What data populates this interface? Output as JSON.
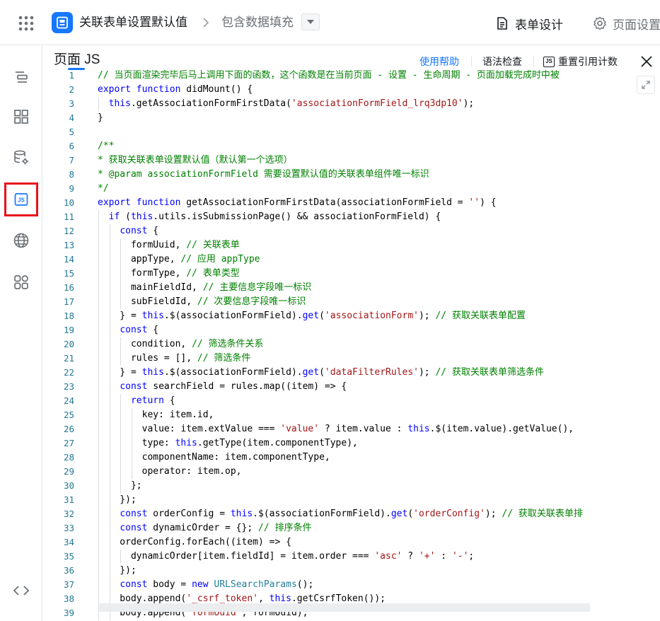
{
  "topbar": {
    "app_title": "关联表单设置默认值",
    "page_name": "包含数据填充",
    "tab_form": "表单设计",
    "tab_page": "页面设置"
  },
  "panel": {
    "title": "页面 JS",
    "help": "使用帮助",
    "lint": "语法检查",
    "reset": "重置引用计数",
    "js_badge": "JS"
  },
  "rail_icons": [
    "outline-icon",
    "components-icon",
    "datasource-icon",
    "js-icon",
    "globe-icon",
    "plugins-icon",
    "code-icon"
  ],
  "colors": {
    "accent": "#1677ff",
    "active_outline": "#e8121c",
    "keyword": "#0000ff",
    "string": "#a31515",
    "comment": "#008000"
  },
  "code_lines": [
    {
      "n": "1",
      "tokens": [
        [
          "// 当页面渲染完毕后马上调用下面的函数，这个函数是在当前页面 - 设置 - 生命周期 - 页面加载完成时中被",
          "cmt"
        ]
      ]
    },
    {
      "n": "2",
      "tokens": [
        [
          "export",
          "kw"
        ],
        [
          " ",
          ""
        ],
        [
          "function",
          "kw"
        ],
        [
          " didMount() {",
          ""
        ]
      ]
    },
    {
      "n": "3",
      "tokens": [
        [
          "  ",
          ""
        ],
        [
          "this",
          "kw"
        ],
        [
          ".getAssociationFormFirstData(",
          ""
        ],
        [
          "'associationFormField_lrq3dp10'",
          "str"
        ],
        [
          ");",
          ""
        ]
      ]
    },
    {
      "n": "4",
      "tokens": [
        [
          "}",
          ""
        ]
      ]
    },
    {
      "n": "5",
      "tokens": [
        [
          "",
          ""
        ]
      ]
    },
    {
      "n": "6",
      "tokens": [
        [
          "/**",
          "cmt"
        ]
      ]
    },
    {
      "n": "7",
      "tokens": [
        [
          "* 获取关联表单设置默认值（默认第一个选项）",
          "cmt"
        ]
      ]
    },
    {
      "n": "8",
      "tokens": [
        [
          "* @param associationFormField 需要设置默认值的关联表单组件唯一标识",
          "cmt"
        ]
      ]
    },
    {
      "n": "9",
      "tokens": [
        [
          "*/",
          "cmt"
        ]
      ]
    },
    {
      "n": "10",
      "tokens": [
        [
          "export",
          "kw"
        ],
        [
          " ",
          ""
        ],
        [
          "function",
          "kw"
        ],
        [
          " getAssociationFormFirstData(associationFormField = ",
          ""
        ],
        [
          "''",
          "str"
        ],
        [
          ") {",
          ""
        ]
      ]
    },
    {
      "n": "11",
      "tokens": [
        [
          "  ",
          ""
        ],
        [
          "if",
          "kw"
        ],
        [
          " (",
          ""
        ],
        [
          "this",
          "kw"
        ],
        [
          ".utils.isSubmissionPage() && associationFormField) {",
          ""
        ]
      ]
    },
    {
      "n": "12",
      "tokens": [
        [
          "    ",
          ""
        ],
        [
          "const",
          "kw"
        ],
        [
          " {",
          ""
        ]
      ]
    },
    {
      "n": "13",
      "tokens": [
        [
          "      formUuid, ",
          ""
        ],
        [
          "// 关联表单",
          "cmt"
        ]
      ]
    },
    {
      "n": "14",
      "tokens": [
        [
          "      appType, ",
          ""
        ],
        [
          "// 应用 appType",
          "cmt"
        ]
      ]
    },
    {
      "n": "15",
      "tokens": [
        [
          "      formType, ",
          ""
        ],
        [
          "// 表单类型",
          "cmt"
        ]
      ]
    },
    {
      "n": "16",
      "tokens": [
        [
          "      mainFieldId, ",
          ""
        ],
        [
          "// 主要信息字段唯一标识",
          "cmt"
        ]
      ]
    },
    {
      "n": "17",
      "tokens": [
        [
          "      subFieldId, ",
          ""
        ],
        [
          "// 次要信息字段唯一标识",
          "cmt"
        ]
      ]
    },
    {
      "n": "18",
      "tokens": [
        [
          "    } = ",
          ""
        ],
        [
          "this",
          "kw"
        ],
        [
          ".$(associationFormField).",
          ""
        ],
        [
          "get",
          "kw"
        ],
        [
          "(",
          ""
        ],
        [
          "'associationForm'",
          "str"
        ],
        [
          "); ",
          ""
        ],
        [
          "// 获取关联表单配置",
          "cmt"
        ]
      ]
    },
    {
      "n": "19",
      "tokens": [
        [
          "    ",
          ""
        ],
        [
          "const",
          "kw"
        ],
        [
          " {",
          ""
        ]
      ]
    },
    {
      "n": "20",
      "tokens": [
        [
          "      condition, ",
          ""
        ],
        [
          "// 筛选条件关系",
          "cmt"
        ]
      ]
    },
    {
      "n": "21",
      "tokens": [
        [
          "      rules = [], ",
          ""
        ],
        [
          "// 筛选条件",
          "cmt"
        ]
      ]
    },
    {
      "n": "22",
      "tokens": [
        [
          "    } = ",
          ""
        ],
        [
          "this",
          "kw"
        ],
        [
          ".$(associationFormField).",
          ""
        ],
        [
          "get",
          "kw"
        ],
        [
          "(",
          ""
        ],
        [
          "'dataFilterRules'",
          "str"
        ],
        [
          "); ",
          ""
        ],
        [
          "// 获取关联表单筛选条件",
          "cmt"
        ]
      ]
    },
    {
      "n": "23",
      "tokens": [
        [
          "    ",
          ""
        ],
        [
          "const",
          "kw"
        ],
        [
          " searchField = rules.map((item) => {",
          ""
        ]
      ]
    },
    {
      "n": "24",
      "tokens": [
        [
          "      ",
          ""
        ],
        [
          "return",
          "kw"
        ],
        [
          " {",
          ""
        ]
      ]
    },
    {
      "n": "25",
      "tokens": [
        [
          "        key: item.id,",
          ""
        ]
      ]
    },
    {
      "n": "26",
      "tokens": [
        [
          "        value: item.extValue === ",
          ""
        ],
        [
          "'value'",
          "str"
        ],
        [
          " ? item.value : ",
          ""
        ],
        [
          "this",
          "kw"
        ],
        [
          ".$(item.value).getValue(),",
          ""
        ]
      ]
    },
    {
      "n": "27",
      "tokens": [
        [
          "        type: ",
          ""
        ],
        [
          "this",
          "kw"
        ],
        [
          ".getType(item.componentType),",
          ""
        ]
      ]
    },
    {
      "n": "28",
      "tokens": [
        [
          "        componentName: item.componentType,",
          ""
        ]
      ]
    },
    {
      "n": "29",
      "tokens": [
        [
          "        operator: item.op,",
          ""
        ]
      ]
    },
    {
      "n": "30",
      "tokens": [
        [
          "      };",
          ""
        ]
      ]
    },
    {
      "n": "31",
      "tokens": [
        [
          "    });",
          ""
        ]
      ]
    },
    {
      "n": "32",
      "tokens": [
        [
          "    ",
          ""
        ],
        [
          "const",
          "kw"
        ],
        [
          " orderConfig = ",
          ""
        ],
        [
          "this",
          "kw"
        ],
        [
          ".$(associationFormField).",
          ""
        ],
        [
          "get",
          "kw"
        ],
        [
          "(",
          ""
        ],
        [
          "'orderConfig'",
          "str"
        ],
        [
          "); ",
          ""
        ],
        [
          "// 获取关联表单排",
          "cmt"
        ]
      ]
    },
    {
      "n": "33",
      "tokens": [
        [
          "    ",
          ""
        ],
        [
          "const",
          "kw"
        ],
        [
          " dynamicOrder = {}; ",
          ""
        ],
        [
          "// 排序条件",
          "cmt"
        ]
      ]
    },
    {
      "n": "34",
      "tokens": [
        [
          "    orderConfig.forEach((item) => {",
          ""
        ]
      ]
    },
    {
      "n": "35",
      "tokens": [
        [
          "      dynamicOrder[item.fieldId] = item.order === ",
          ""
        ],
        [
          "'asc'",
          "str"
        ],
        [
          " ? ",
          ""
        ],
        [
          "'+'",
          "str"
        ],
        [
          " : ",
          ""
        ],
        [
          "'-'",
          "str"
        ],
        [
          ";",
          ""
        ]
      ]
    },
    {
      "n": "36",
      "tokens": [
        [
          "    });",
          ""
        ]
      ]
    },
    {
      "n": "37",
      "tokens": [
        [
          "    ",
          ""
        ],
        [
          "const",
          "kw"
        ],
        [
          " body = ",
          ""
        ],
        [
          "new",
          "kw"
        ],
        [
          " ",
          ""
        ],
        [
          "URLSearchParams",
          "ty"
        ],
        [
          "();",
          ""
        ]
      ]
    },
    {
      "n": "38",
      "tokens": [
        [
          "    body.append(",
          ""
        ],
        [
          "'_csrf_token'",
          "str"
        ],
        [
          ", ",
          ""
        ],
        [
          "this",
          "kw"
        ],
        [
          ".getCsrfToken());",
          ""
        ]
      ]
    },
    {
      "n": "39",
      "tokens": [
        [
          "    body.append(",
          ""
        ],
        [
          "'formUuid'",
          "str"
        ],
        [
          ", formUuid);",
          ""
        ]
      ]
    }
  ]
}
